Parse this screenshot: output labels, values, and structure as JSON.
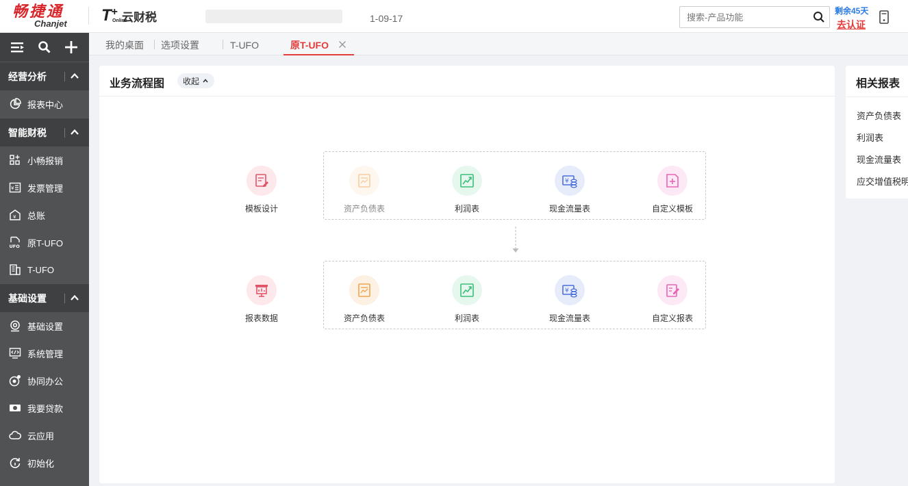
{
  "header": {
    "brand_cn": "畅捷通",
    "brand_en": "Chanjet",
    "product_t": "T",
    "product_plus": "+",
    "product_online": "Online",
    "product_name": "云财税",
    "date_text": "1-09-17",
    "search_placeholder": "搜索-产品功能",
    "remaining_text": "剩余45天",
    "verify_text": "去认证"
  },
  "sidebar": {
    "toolbar_icons": [
      "menu-toggle-icon",
      "search-icon",
      "plus-icon"
    ],
    "groups": [
      {
        "label": "经营分析",
        "items": [
          {
            "label": "报表中心",
            "icon": "pie-chart-icon"
          }
        ]
      },
      {
        "label": "智能财税",
        "items": [
          {
            "label": "小畅报销",
            "icon": "grid-plus-icon"
          },
          {
            "label": "发票管理",
            "icon": "invoice-icon"
          },
          {
            "label": "总账",
            "icon": "ledger-icon"
          },
          {
            "label": "原T-UFO",
            "icon": "ufo-file-icon"
          },
          {
            "label": "T-UFO",
            "icon": "building-icon"
          }
        ]
      },
      {
        "label": "基础设置",
        "items": [
          {
            "label": "基础设置",
            "icon": "settings-icon"
          },
          {
            "label": "系统管理",
            "icon": "monitor-code-icon"
          },
          {
            "label": "协同办公",
            "icon": "collab-icon"
          },
          {
            "label": "我要贷款",
            "icon": "money-icon"
          },
          {
            "label": "云应用",
            "icon": "cloud-icon"
          },
          {
            "label": "初始化",
            "icon": "refresh-icon"
          }
        ]
      }
    ]
  },
  "tabs": [
    {
      "label": "我的桌面"
    },
    {
      "label": "选项设置"
    },
    {
      "label": "T-UFO"
    },
    {
      "label": "原T-UFO",
      "active": true
    }
  ],
  "main": {
    "title": "业务流程图",
    "collapse_label": "收起",
    "row1": {
      "start": {
        "label": "模板设计",
        "icon": "template-design-icon"
      },
      "items": [
        {
          "label": "资产负债表",
          "icon": "balance-sheet-icon",
          "disabled": true
        },
        {
          "label": "利润表",
          "icon": "profit-chart-icon"
        },
        {
          "label": "现金流量表",
          "icon": "cash-flow-icon"
        },
        {
          "label": "自定义模板",
          "icon": "custom-template-icon"
        }
      ]
    },
    "row2": {
      "start": {
        "label": "报表数据",
        "icon": "report-data-icon"
      },
      "items": [
        {
          "label": "资产负债表",
          "icon": "balance-sheet-icon"
        },
        {
          "label": "利润表",
          "icon": "profit-chart-icon"
        },
        {
          "label": "现金流量表",
          "icon": "cash-flow-icon"
        },
        {
          "label": "自定义报表",
          "icon": "custom-report-icon"
        }
      ]
    }
  },
  "related": {
    "title": "相关报表",
    "items": [
      "资产负债表",
      "利润表",
      "现金流量表",
      "应交增值税明细表"
    ]
  },
  "colors": {
    "brand_red": "#d9252a",
    "accent_red": "#e43b3b",
    "sidebar_bg": "#505254",
    "sidebar_group_bg": "#3e4042",
    "link_blue": "#2a7ae2"
  }
}
